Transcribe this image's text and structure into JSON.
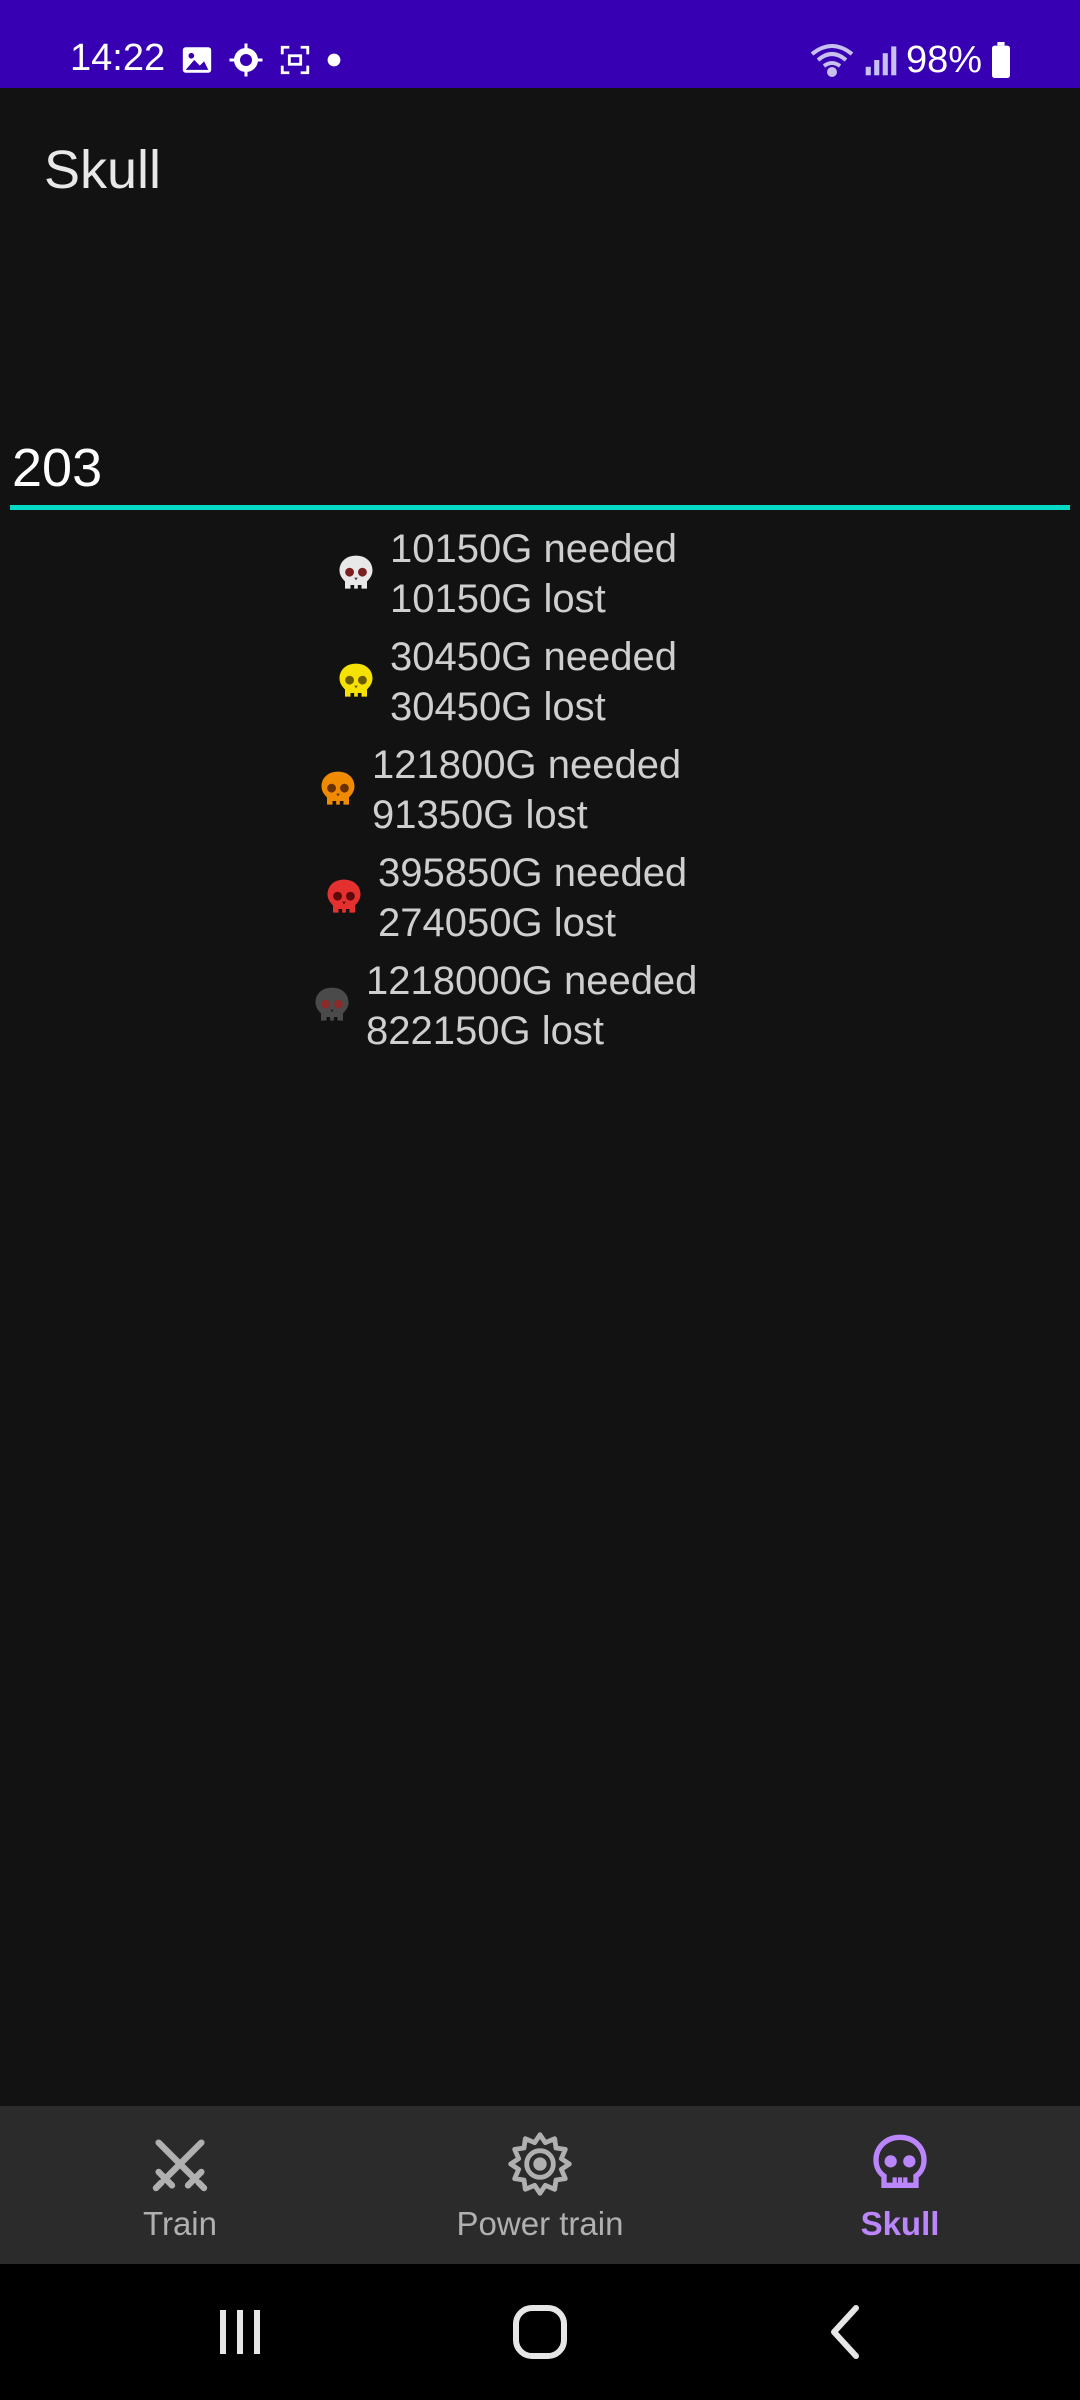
{
  "status_bar": {
    "time": "14:22",
    "battery": "98%",
    "left_icons": [
      "image-icon",
      "gear-face-icon",
      "screenshot-icon",
      "dot-icon"
    ],
    "right_icons": [
      "wifi-icon",
      "signal-icon",
      "battery-icon"
    ]
  },
  "app": {
    "title": "Skull"
  },
  "level_input": {
    "value": "203"
  },
  "skulls": [
    {
      "color_name": "white",
      "color": "#e8e8e8",
      "needed": "10150G needed",
      "lost": "10150G lost"
    },
    {
      "color_name": "yellow",
      "color": "#f5e200",
      "needed": "30450G needed",
      "lost": "30450G lost"
    },
    {
      "color_name": "orange",
      "color": "#f08a00",
      "needed": "121800G needed",
      "lost": "91350G lost"
    },
    {
      "color_name": "red",
      "color": "#e53030",
      "needed": "395850G needed",
      "lost": "274050G lost"
    },
    {
      "color_name": "gray",
      "color": "#4a4a4a",
      "needed": "1218000G needed",
      "lost": "822150G lost"
    }
  ],
  "bottom_nav": {
    "items": [
      {
        "label": "Train",
        "icon": "crossed-swords-icon",
        "active": false
      },
      {
        "label": "Power train",
        "icon": "gear-icon",
        "active": false
      },
      {
        "label": "Skull",
        "icon": "skull-icon",
        "active": true
      }
    ]
  },
  "colors": {
    "status_bar": "#3700b3",
    "background": "#121212",
    "accent_teal": "#03dac5",
    "accent_purple": "#bb86fc",
    "nav_background": "#2b2b2b"
  }
}
